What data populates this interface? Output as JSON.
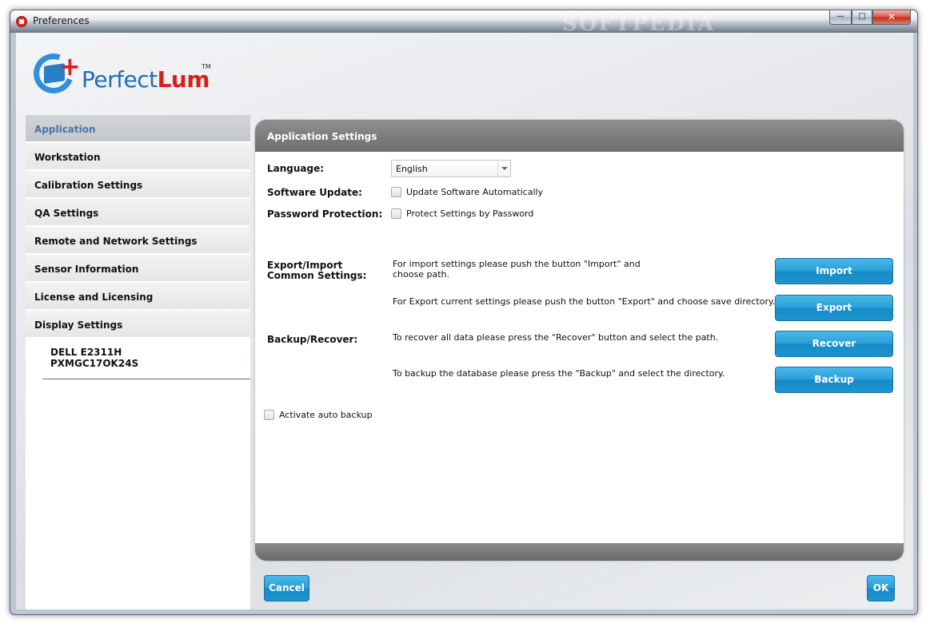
{
  "window": {
    "title": "Preferences",
    "watermark": "SOFTPEDIA",
    "minimize_glyph": "—",
    "maximize_glyph": "□",
    "close_glyph": "✕"
  },
  "logo": {
    "text_plain": "Perfect",
    "text_bold": "Lum",
    "tm": "TM"
  },
  "sidebar": {
    "items": [
      {
        "label": "Application",
        "active": true
      },
      {
        "label": "Workstation"
      },
      {
        "label": "Calibration Settings"
      },
      {
        "label": "QA Settings"
      },
      {
        "label": "Remote and Network Settings"
      },
      {
        "label": "Sensor Information"
      },
      {
        "label": "License and Licensing"
      },
      {
        "label": "Display Settings"
      }
    ],
    "device": {
      "name": "DELL E2311H",
      "serial": "PXMGC17OK24S"
    }
  },
  "panel": {
    "title": "Application Settings",
    "language_label": "Language:",
    "language_value": "English",
    "software_update_label": "Software Update:",
    "software_update_option": "Update Software Automatically",
    "password_label": "Password Protection:",
    "password_option": "Protect Settings by Password",
    "export_import_label_1": "Export/Import",
    "export_import_label_2": "Common Settings:",
    "import_text_1": "For import settings please push the button \"Import\" and",
    "import_text_2": "choose path.",
    "import_button": "Import",
    "export_text": "For Export current settings please push the button \"Export\" and choose save directory.",
    "export_button": "Export",
    "backup_label": "Backup/Recover:",
    "recover_text": "To recover all data please press the \"Recover\" button and select the path.",
    "recover_button": "Recover",
    "backup_text": "To backup the database please press the \"Backup\" and select the directory.",
    "backup_button": "Backup",
    "auto_backup_option": "Activate auto backup"
  },
  "footer": {
    "cancel_label": "Cancel",
    "ok_label": "OK"
  },
  "colors": {
    "accent_blue": "#2a9fda",
    "active_nav_text": "#4a74a8",
    "panel_header": "#7a7a7a"
  }
}
